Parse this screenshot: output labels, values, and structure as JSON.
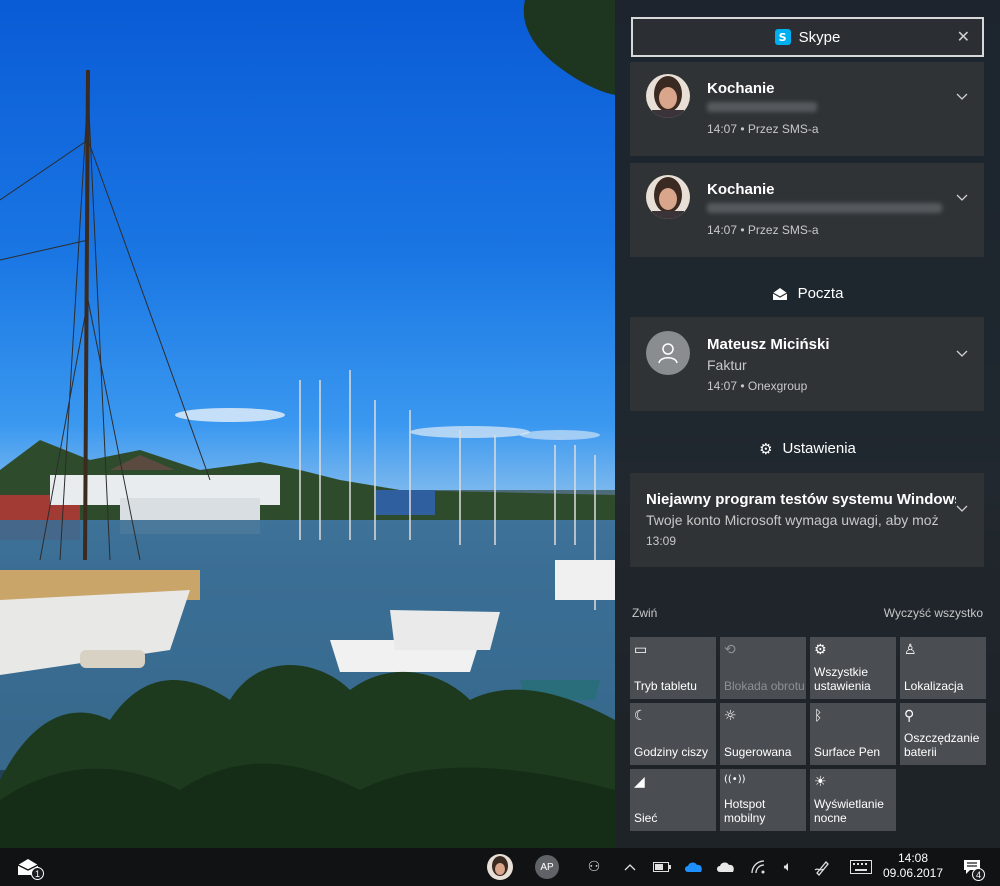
{
  "skype_notifications": {
    "app_name": "Skype",
    "close_icon": "close-icon",
    "items": [
      {
        "sender": "Kochanie",
        "meta": "14:07 • Przez SMS-a"
      },
      {
        "sender": "Kochanie",
        "meta": "14:07 • Przez SMS-a"
      }
    ]
  },
  "mail_group": {
    "title": "Poczta",
    "item": {
      "sender": "Mateusz Miciński",
      "subject": "Faktur",
      "meta": "14:07 • Onexgroup"
    }
  },
  "settings_group": {
    "title": "Ustawienia",
    "item": {
      "title": "Niejawny program testów systemu Windows",
      "body": "Twoje konto Microsoft wymaga uwagi, aby moż",
      "meta": "13:09"
    }
  },
  "controls": {
    "collapse": "Zwiń",
    "clear_all": "Wyczyść wszystko"
  },
  "quick_actions": [
    {
      "label": "Tryb tabletu",
      "icon": "tablet-mode-icon",
      "glyph": "▭"
    },
    {
      "label": "Blokada obrotu",
      "icon": "rotation-lock-icon",
      "glyph": "⟲",
      "disabled": true
    },
    {
      "label": "Wszystkie ustawienia",
      "icon": "gear-icon",
      "glyph": "⚙"
    },
    {
      "label": "Lokalizacja",
      "icon": "location-icon",
      "glyph": "♙"
    },
    {
      "label": "Godziny ciszy",
      "icon": "moon-icon",
      "glyph": "☾"
    },
    {
      "label": "Sugerowana",
      "icon": "brightness-icon",
      "glyph": "☼"
    },
    {
      "label": "Surface Pen",
      "icon": "bluetooth-icon",
      "glyph": "ᛒ"
    },
    {
      "label": "Oszczędzanie baterii",
      "icon": "battery-saver-icon",
      "glyph": "⚲"
    },
    {
      "label": "Sieć",
      "icon": "network-icon",
      "glyph": "◢"
    },
    {
      "label": "Hotspot mobilny",
      "icon": "hotspot-icon",
      "glyph": "((•))"
    },
    {
      "label": "Wyświetlanie nocne",
      "icon": "night-light-icon",
      "glyph": "☀"
    }
  ],
  "taskbar": {
    "mail_badge": "1",
    "people_initials": "AP",
    "time": "14:08",
    "date": "09.06.2017",
    "notification_count": "4"
  }
}
